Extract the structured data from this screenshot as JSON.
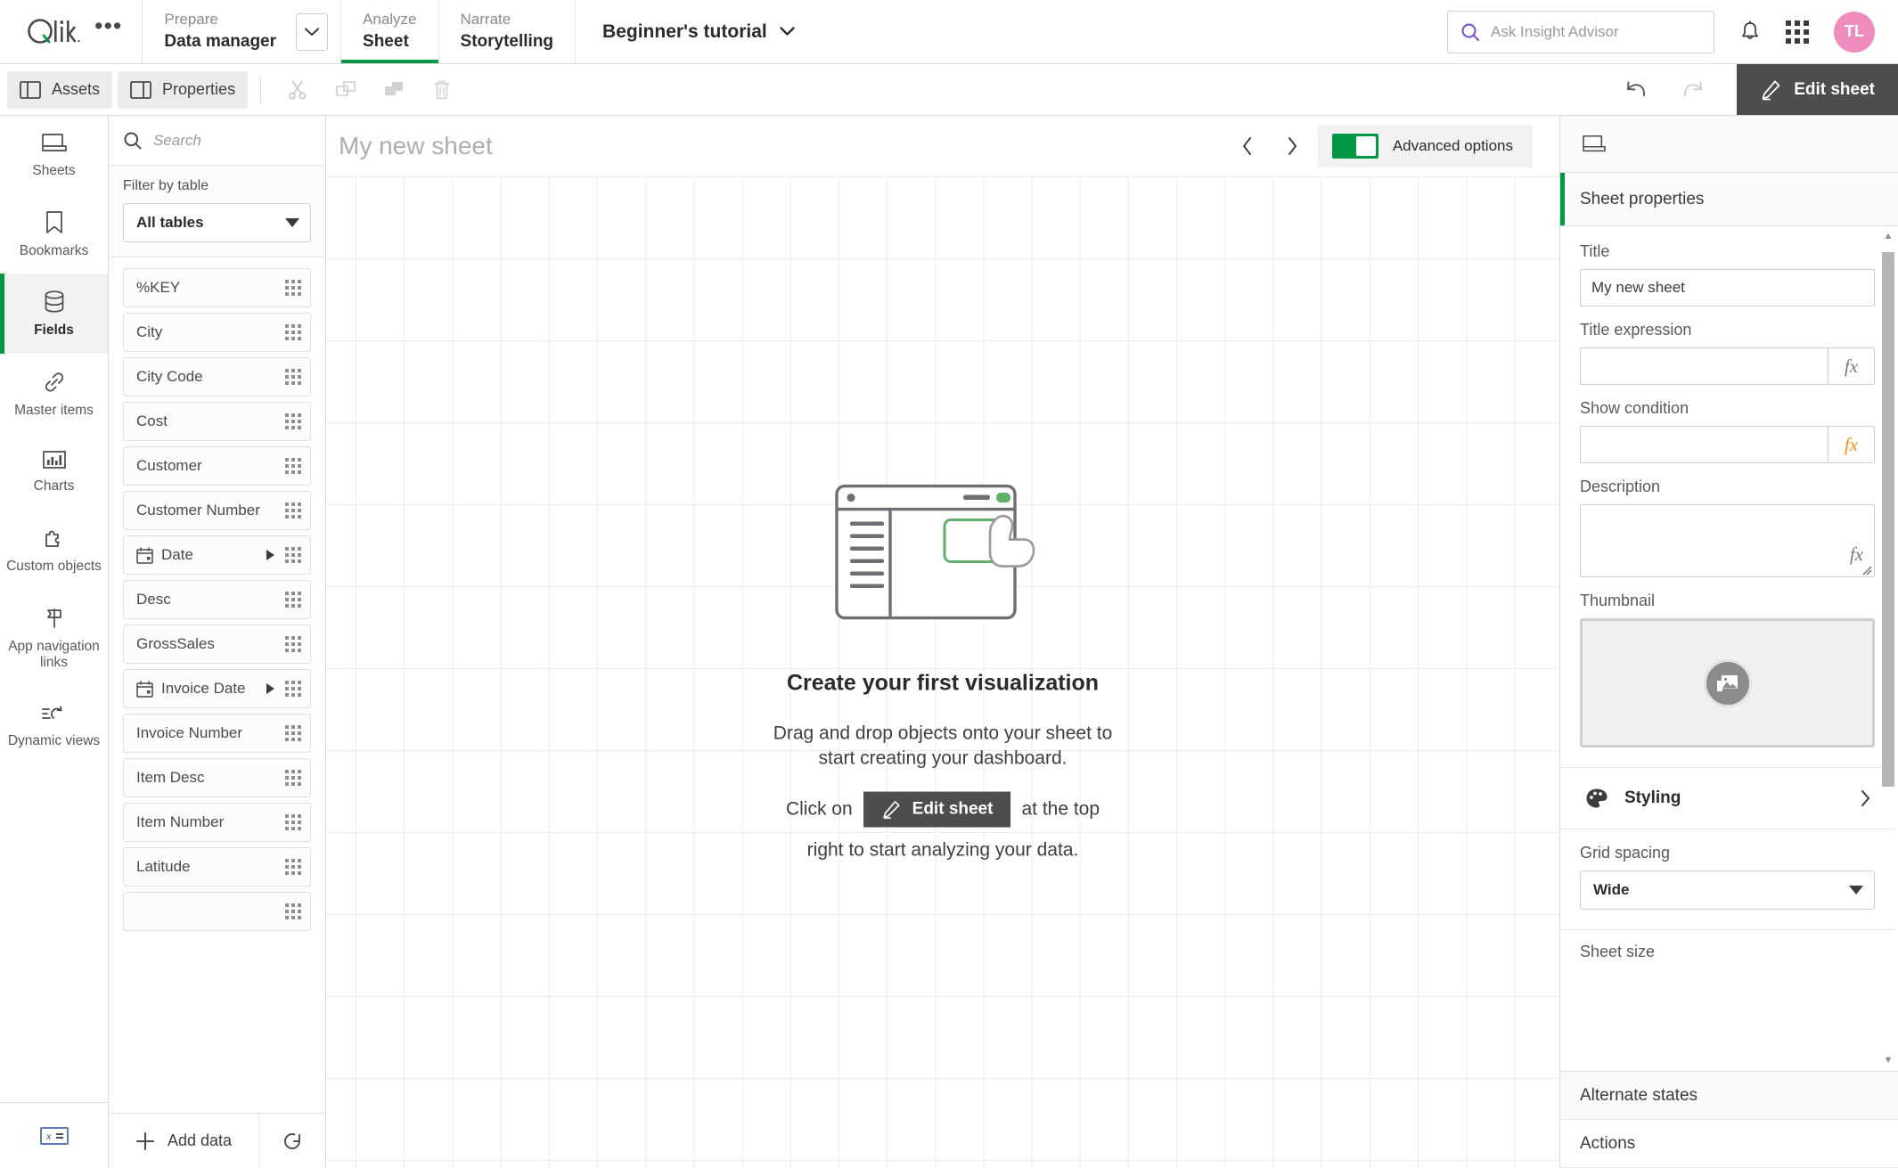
{
  "topbar": {
    "logo_text": "Qlik",
    "overflow_menu": "•••",
    "sections": [
      {
        "top": "Prepare",
        "bottom": "Data manager",
        "has_caret": true,
        "active": false
      },
      {
        "top": "Analyze",
        "bottom": "Sheet",
        "has_caret": false,
        "active": true
      },
      {
        "top": "Narrate",
        "bottom": "Storytelling",
        "has_caret": false,
        "active": false
      }
    ],
    "app_title": "Beginner's tutorial",
    "search_placeholder": "Ask Insight Advisor",
    "notifications_icon": "bell-icon",
    "apps_grid_icon": "grid-menu-icon",
    "avatar_initials": "TL",
    "avatar_color": "#ee8cbd",
    "accent_color": "#009845"
  },
  "toolbar": {
    "assets_label": "Assets",
    "properties_label": "Properties",
    "cut_icon": "scissors-icon",
    "copy_icon": "copy-icon",
    "paste_icon": "paste-icon",
    "delete_icon": "trash-icon",
    "undo_icon": "undo-arrow-icon",
    "redo_icon": "redo-arrow-icon",
    "edit_sheet_label": "Edit sheet"
  },
  "rail": {
    "items": [
      {
        "label": "Sheets",
        "icon": "sheet-icon",
        "active": false
      },
      {
        "label": "Bookmarks",
        "icon": "bookmark-icon",
        "active": false
      },
      {
        "label": "Fields",
        "icon": "database-icon",
        "active": true
      },
      {
        "label": "Master items",
        "icon": "link-icon",
        "active": false
      },
      {
        "label": "Charts",
        "icon": "bar-chart-icon",
        "active": false
      },
      {
        "label": "Custom objects",
        "icon": "puzzle-icon",
        "active": false
      },
      {
        "label": "App navigation links",
        "icon": "flag-icon",
        "active": false
      },
      {
        "label": "Dynamic views",
        "icon": "dynamic-refresh-icon",
        "active": false
      }
    ],
    "bottom_icon": "variables-icon"
  },
  "assets": {
    "search_placeholder": "Search",
    "filter_label": "Filter by table",
    "filter_value": "All tables",
    "fields": [
      {
        "name": "%KEY",
        "is_date": false,
        "expandable": false
      },
      {
        "name": "City",
        "is_date": false,
        "expandable": false
      },
      {
        "name": "City Code",
        "is_date": false,
        "expandable": false
      },
      {
        "name": "Cost",
        "is_date": false,
        "expandable": false
      },
      {
        "name": "Customer",
        "is_date": false,
        "expandable": false
      },
      {
        "name": "Customer Number",
        "is_date": false,
        "expandable": false
      },
      {
        "name": "Date",
        "is_date": true,
        "expandable": true
      },
      {
        "name": "Desc",
        "is_date": false,
        "expandable": false
      },
      {
        "name": "GrossSales",
        "is_date": false,
        "expandable": false
      },
      {
        "name": "Invoice Date",
        "is_date": true,
        "expandable": true
      },
      {
        "name": "Invoice Number",
        "is_date": false,
        "expandable": false
      },
      {
        "name": "Item Desc",
        "is_date": false,
        "expandable": false
      },
      {
        "name": "Item Number",
        "is_date": false,
        "expandable": false
      },
      {
        "name": "Latitude",
        "is_date": false,
        "expandable": false
      }
    ],
    "add_data_label": "Add data",
    "reload_icon": "reload-icon"
  },
  "canvas": {
    "sheet_title": "My new sheet",
    "prev_icon": "chevron-left-icon",
    "next_icon": "chevron-right-icon",
    "advanced_options_label": "Advanced options",
    "advanced_options_on": true,
    "empty_state": {
      "title": "Create your first visualization",
      "line1": "Drag and drop objects onto your sheet to",
      "line2": "start creating your dashboard.",
      "line3_pre": "Click on",
      "button_label": "Edit sheet",
      "line3_post": "at the top",
      "line4": "right to start analyzing your data."
    }
  },
  "properties": {
    "tab_icon": "sheet-icon",
    "header": "Sheet properties",
    "title_label": "Title",
    "title_value": "My new sheet",
    "title_expression_label": "Title expression",
    "title_expression_value": "",
    "show_condition_label": "Show condition",
    "show_condition_value": "",
    "description_label": "Description",
    "description_value": "",
    "thumbnail_label": "Thumbnail",
    "thumbnail_icon": "image-placeholder-icon",
    "styling_label": "Styling",
    "styling_icon": "palette-icon",
    "grid_spacing_label": "Grid spacing",
    "grid_spacing_value": "Wide",
    "sheet_size_label": "Sheet size",
    "alternate_states_label": "Alternate states",
    "actions_label": "Actions"
  }
}
